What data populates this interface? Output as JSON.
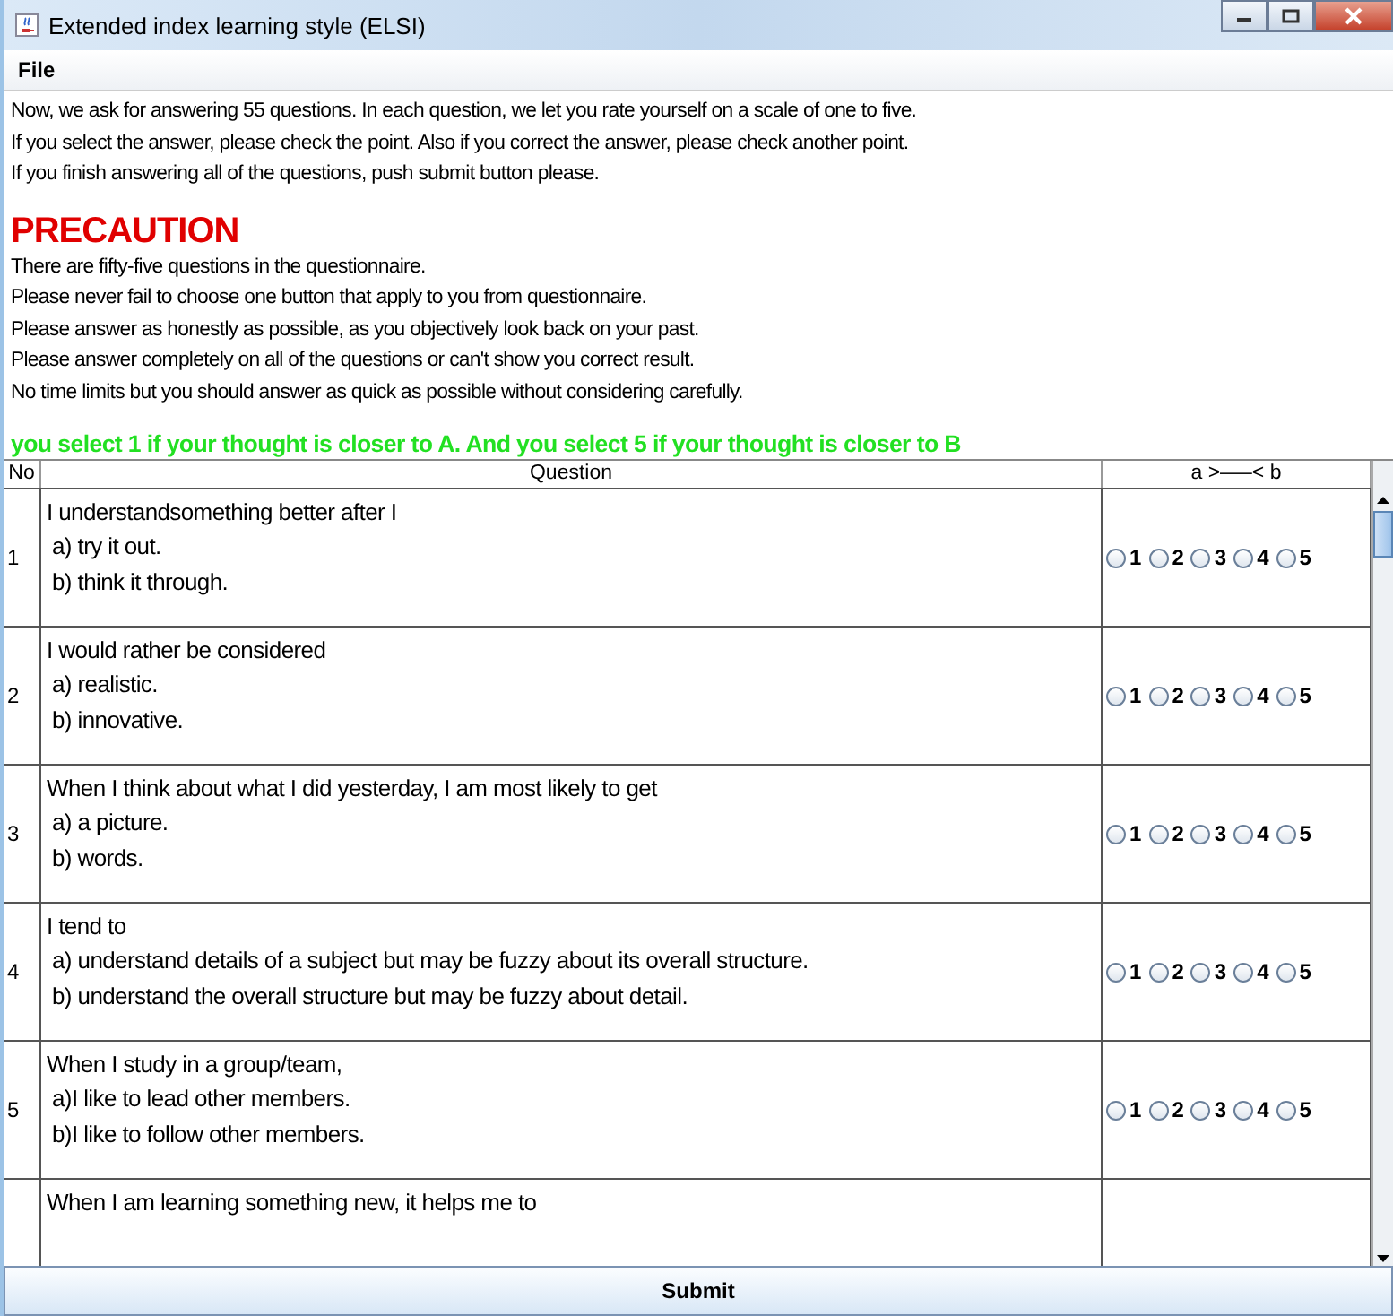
{
  "window": {
    "title": "Extended index learning style (ELSI)"
  },
  "menu": [
    {
      "label": "File"
    }
  ],
  "intro": [
    "Now, we ask for answering 55 questions. In each question, we let you rate yourself on a scale of one to five.",
    "If you select the answer, please check the point. Also if you correct the answer, please check another point.",
    "If you finish answering all of the questions, push submit button please."
  ],
  "precaution": {
    "title": "PRECAUTION",
    "lines": [
      "There are fifty-five questions in the questionnaire.",
      "Please never fail to choose one button that apply to you from questionnaire.",
      "Please answer as honestly as possible, as you objectively look back on your past.",
      "Please answer completely on all of the questions or can't show you correct result.",
      "No time limits but you should answer as quick as possible without considering carefully."
    ]
  },
  "instruction": "you select 1 if your thought is closer to A. And you select 5 if your thought is closer to B",
  "table": {
    "columns": [
      "No",
      "Question",
      "a >—–< b"
    ],
    "rows": [
      {
        "no": "1",
        "lines": [
          "I understandsomething better after I",
          "a) try it out.",
          "b) think it through."
        ],
        "options": [
          {
            "label": "1",
            "selected": false
          },
          {
            "label": "2",
            "selected": false
          },
          {
            "label": "3",
            "selected": false
          },
          {
            "label": "4",
            "selected": false
          },
          {
            "label": "5",
            "selected": false
          }
        ]
      },
      {
        "no": "2",
        "lines": [
          "I would rather be considered",
          "a) realistic.",
          "b) innovative."
        ],
        "options": [
          {
            "label": "1",
            "selected": false
          },
          {
            "label": "2",
            "selected": false
          },
          {
            "label": "3",
            "selected": false
          },
          {
            "label": "4",
            "selected": false
          },
          {
            "label": "5",
            "selected": false
          }
        ]
      },
      {
        "no": "3",
        "lines": [
          "When I think about what I did yesterday, I am most likely to get",
          "a) a picture.",
          "b) words."
        ],
        "options": [
          {
            "label": "1",
            "selected": false
          },
          {
            "label": "2",
            "selected": false
          },
          {
            "label": "3",
            "selected": false
          },
          {
            "label": "4",
            "selected": false
          },
          {
            "label": "5",
            "selected": false
          }
        ]
      },
      {
        "no": "4",
        "lines": [
          "I tend to",
          "a) understand details of a subject but may be fuzzy about its overall structure.",
          "b) understand the overall structure but may be fuzzy about detail."
        ],
        "options": [
          {
            "label": "1",
            "selected": false
          },
          {
            "label": "2",
            "selected": false
          },
          {
            "label": "3",
            "selected": false
          },
          {
            "label": "4",
            "selected": false
          },
          {
            "label": "5",
            "selected": false
          }
        ]
      },
      {
        "no": "5",
        "lines": [
          "When I study in a group/team,",
          "a)I like to lead other members.",
          "b)I like to follow other members."
        ],
        "options": [
          {
            "label": "1",
            "selected": false
          },
          {
            "label": "2",
            "selected": false
          },
          {
            "label": "3",
            "selected": false
          },
          {
            "label": "4",
            "selected": false
          },
          {
            "label": "5",
            "selected": false
          }
        ]
      },
      {
        "no": "",
        "lines": [
          "When I am learning something new, it helps me to"
        ],
        "options": []
      }
    ]
  },
  "submit": "Submit"
}
